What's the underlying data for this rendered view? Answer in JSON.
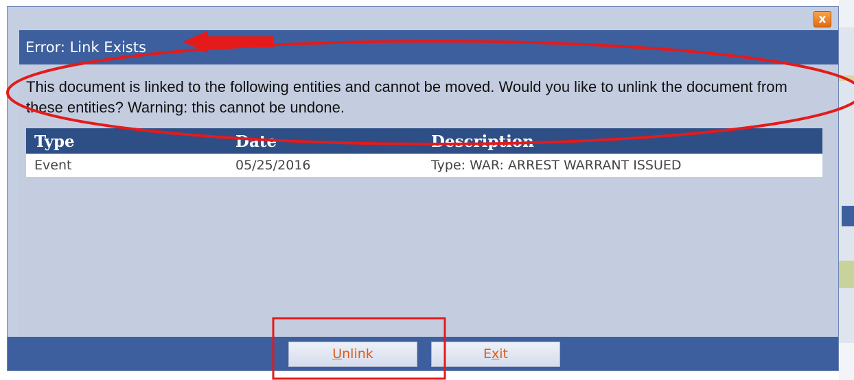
{
  "dialog": {
    "title": "Error: Link Exists",
    "close_glyph": "x",
    "message": "This document is linked to the following entities and cannot be moved. Would you like to unlink the document from these entities? Warning: this cannot be undone."
  },
  "grid": {
    "columns": [
      "Type",
      "Date",
      "Description"
    ],
    "rows": [
      {
        "type": "Event",
        "date": "05/25/2016",
        "description": "Type: WAR: ARREST WARRANT ISSUED"
      }
    ]
  },
  "buttons": {
    "unlink": {
      "accesskey": "U",
      "rest": "nlink"
    },
    "exit": {
      "pre": "E",
      "accesskey": "x",
      "rest": "it"
    }
  },
  "colors": {
    "title_bar": "#3d5f9e",
    "grid_header": "#2e4e86",
    "button_text": "#e05a16",
    "annotation": "#e51a1a"
  },
  "icons": [
    "close-icon",
    "arrow-annotation",
    "ellipse-annotation",
    "rect-annotation"
  ]
}
